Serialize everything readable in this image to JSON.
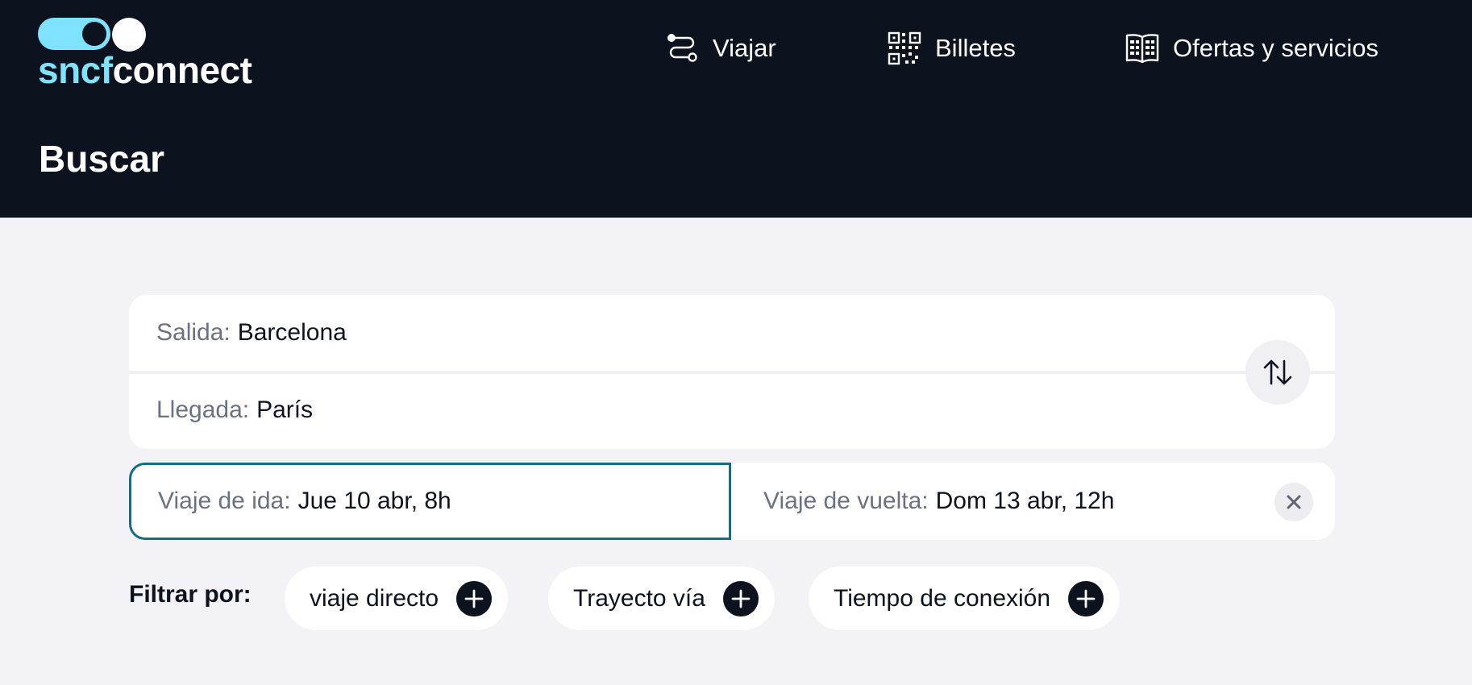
{
  "brand": {
    "logo_part1": "sncf",
    "logo_part2": "connect",
    "accent_color": "#7fe3ff",
    "header_bg": "#0c131f"
  },
  "nav": {
    "items": [
      {
        "label": "Viajar",
        "icon": "route-icon"
      },
      {
        "label": "Billetes",
        "icon": "qr-code-icon"
      },
      {
        "label": "Ofertas y servicios",
        "icon": "book-icon"
      }
    ]
  },
  "page": {
    "title": "Buscar"
  },
  "search": {
    "origin_label": "Salida:",
    "origin_value": "Barcelona",
    "destination_label": "Llegada:",
    "destination_value": "París",
    "swap_icon": "swap-arrows-icon",
    "outbound_label": "Viaje de ida:",
    "outbound_value": "Jue 10 abr, 8h",
    "return_label": "Viaje de vuelta:",
    "return_value": "Dom 13 abr, 12h",
    "clear_icon": "close-icon",
    "focus_color": "#166c85"
  },
  "filters": {
    "label": "Filtrar por:",
    "chips": [
      {
        "label": "viaje directo",
        "icon": "plus-icon"
      },
      {
        "label": "Trayecto vía",
        "icon": "plus-icon"
      },
      {
        "label": "Tiempo de conexión",
        "icon": "plus-icon"
      }
    ]
  }
}
